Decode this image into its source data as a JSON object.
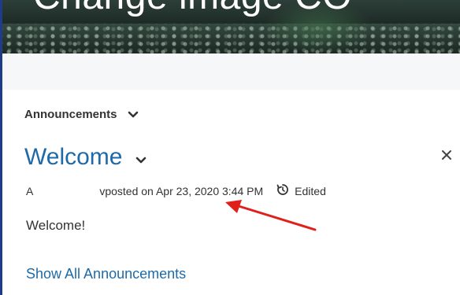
{
  "banner": {
    "title": "Change image CO"
  },
  "announcements": {
    "widget_title": "Announcements",
    "item": {
      "title": "Welcome",
      "author_visible_start": "A",
      "author_visible_end": "v",
      "posted_text": " posted on Apr 23, 2020 3:44 PM",
      "edited_label": "Edited",
      "body": "Welcome!"
    },
    "show_all_label": "Show All Announcements"
  },
  "icons": {
    "chevron": "chevron-down-icon",
    "close": "close-icon",
    "edited": "history-icon"
  },
  "colors": {
    "link": "#1e6aa8",
    "annotation_arrow": "#e0201b",
    "left_border": "#1f3c88"
  }
}
